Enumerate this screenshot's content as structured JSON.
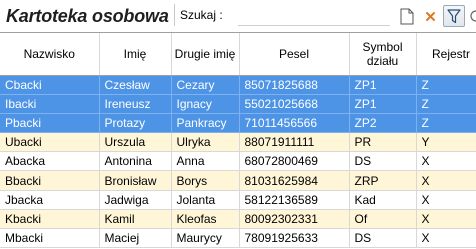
{
  "app": {
    "title": "Kartoteka osobowa"
  },
  "search": {
    "label": "Szukaj  :",
    "value": "",
    "placeholder": ""
  },
  "toolbar": {
    "buttons": [
      {
        "name": "new-document",
        "icon": "new-document-icon"
      },
      {
        "name": "clear",
        "icon": "close-icon",
        "color": "#e07a20"
      },
      {
        "name": "filter",
        "icon": "filter-icon",
        "active": true
      },
      {
        "name": "more",
        "icon": "more-icon"
      }
    ]
  },
  "table": {
    "columns": [
      "Nazwisko",
      "Imię",
      "Drugie imię",
      "Pesel",
      "Symbol działu",
      "Rejestr"
    ],
    "rows": [
      {
        "cells": [
          "Cbacki",
          "Czesław",
          "Cezary",
          "85071825688",
          "ZP1",
          "Z"
        ],
        "state": "selected"
      },
      {
        "cells": [
          "Ibacki",
          "Ireneusz",
          "Ignacy",
          "55021025668",
          "ZP1",
          "Z"
        ],
        "state": "selected"
      },
      {
        "cells": [
          "Pbacki",
          "Protazy",
          "Pankracy",
          "71011456566",
          "ZP2",
          "Z"
        ],
        "state": "selected"
      },
      {
        "cells": [
          "Ubacki",
          "Urszula",
          "Ulryka",
          "88071911111",
          "PR",
          "Y"
        ],
        "state": "cream"
      },
      {
        "cells": [
          "Abacka",
          "Antonina",
          "Anna",
          "68072800469",
          "DS",
          "X"
        ],
        "state": "plain"
      },
      {
        "cells": [
          "Bbacki",
          "Bronisław",
          "Borys",
          "81031625984",
          "ZRP",
          "X"
        ],
        "state": "cream"
      },
      {
        "cells": [
          "Jbacka",
          "Jadwiga",
          "Jolanta",
          "58122136589",
          "Kad",
          "X"
        ],
        "state": "plain"
      },
      {
        "cells": [
          "Kbacki",
          "Kamil",
          "Kleofas",
          "80092302331",
          "Of",
          "X"
        ],
        "state": "cream"
      },
      {
        "cells": [
          "Mbacki",
          "Maciej",
          "Maurycy",
          "78091925633",
          "DS",
          "X"
        ],
        "state": "plain"
      }
    ]
  },
  "colors": {
    "selected_row": "#4d94e6",
    "cream_row": "#fff6d8",
    "plain_row": "#ffffff"
  }
}
